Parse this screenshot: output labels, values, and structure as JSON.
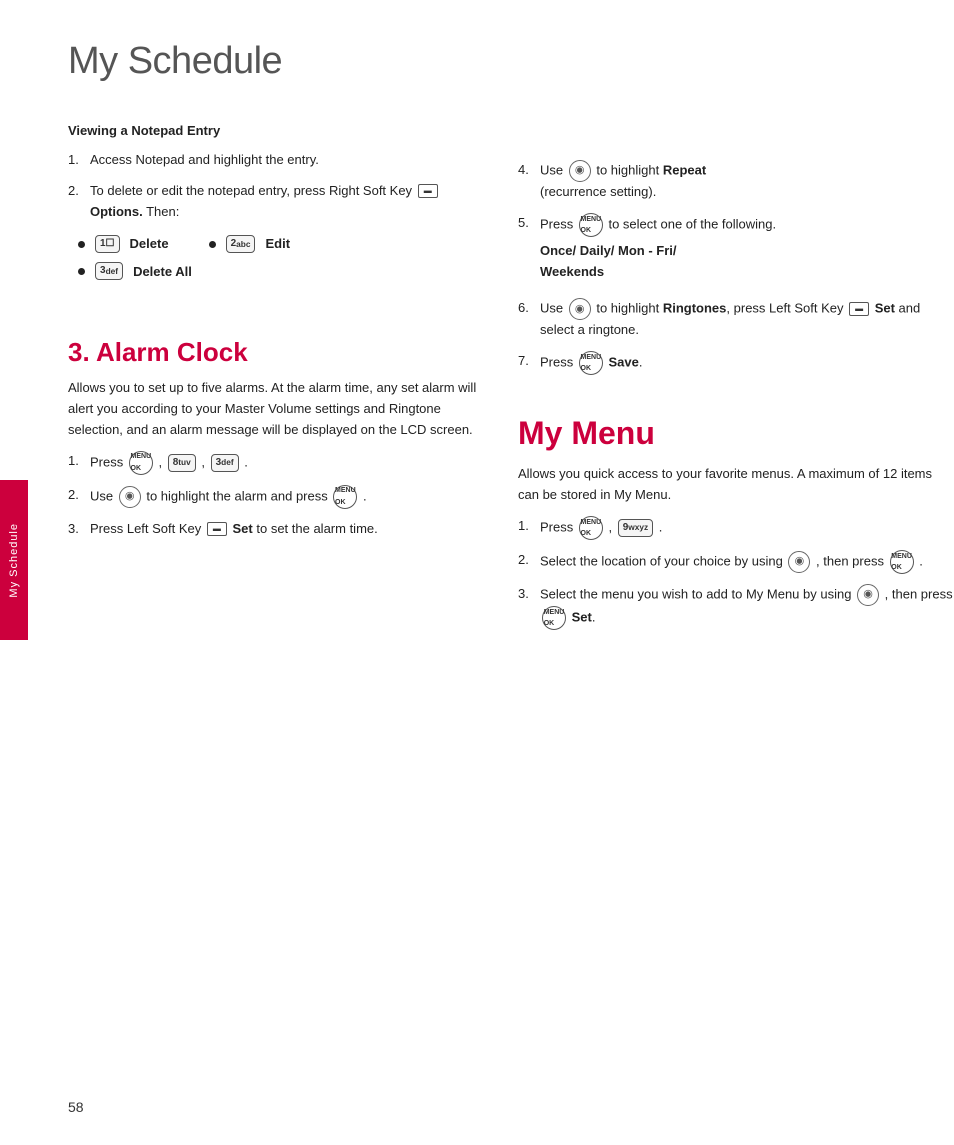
{
  "page": {
    "title": "My Schedule",
    "page_number": "58",
    "side_tab_label": "My Schedule"
  },
  "left_column": {
    "section1": {
      "header": "Viewing a Notepad Entry",
      "items": [
        {
          "num": "1.",
          "text": "Access Notepad and highlight the entry."
        },
        {
          "num": "2.",
          "text": "To delete or edit the notepad entry, press Right Soft Key",
          "suffix": " Options. Then:"
        }
      ],
      "bullets": [
        {
          "key": "1",
          "label": "Delete"
        },
        {
          "key": "2abc",
          "label": "Edit"
        },
        {
          "key": "3def",
          "label": "Delete All"
        }
      ]
    },
    "section2": {
      "header": "3. Alarm Clock",
      "intro": "Allows you to set up to five alarms. At the alarm time, any set alarm will alert you according to your Master Volume settings and Ringtone selection, and an alarm message will be displayed on the LCD screen.",
      "items": [
        {
          "num": "1.",
          "text": "Press",
          "keys": [
            "OK",
            "8tuv",
            "3def"
          ],
          "suffix": "."
        },
        {
          "num": "2.",
          "text": "Use",
          "nav": true,
          "suffix": "to highlight the alarm and press",
          "ok": true,
          "end": "."
        },
        {
          "num": "3.",
          "text": "Press Left Soft Key",
          "softkey": true,
          "label": "Set",
          "suffix": "to set the alarm time."
        }
      ]
    }
  },
  "right_column": {
    "items": [
      {
        "num": "4.",
        "text": "Use",
        "nav": true,
        "suffix": "to highlight",
        "bold_word": "Repeat",
        "end": "(recurrence setting)."
      },
      {
        "num": "5.",
        "text": "Press",
        "ok": true,
        "suffix": "to select one of the following."
      },
      {
        "options_line": "Once/ Daily/ Mon - Fri/ Weekends"
      },
      {
        "num": "6.",
        "text": "Use",
        "nav": true,
        "suffix": "to highlight",
        "bold_word": "Ringtones",
        "end": ", press Left Soft Key",
        "softkey_label": "Set",
        "end2": "and select a ringtone."
      },
      {
        "num": "7.",
        "text": "Press",
        "ok": true,
        "bold_word": "Save",
        "end": "."
      }
    ],
    "my_menu": {
      "header": "My Menu",
      "intro": "Allows you quick access to your favorite menus. A maximum of 12 items can be stored in My Menu.",
      "items": [
        {
          "num": "1.",
          "text": "Press",
          "ok1": true,
          "comma": ",",
          "key": "9wxyz",
          "end": "."
        },
        {
          "num": "2.",
          "text": "Select the location of your choice by using",
          "nav": true,
          "then_text": ", then press",
          "ok": true,
          "end": "."
        },
        {
          "num": "3.",
          "text": "Select the menu you wish to add to My Menu by using",
          "nav": true,
          "then_text": ", then press",
          "ok": true,
          "bold_word": "Set",
          "end": "."
        }
      ]
    }
  }
}
